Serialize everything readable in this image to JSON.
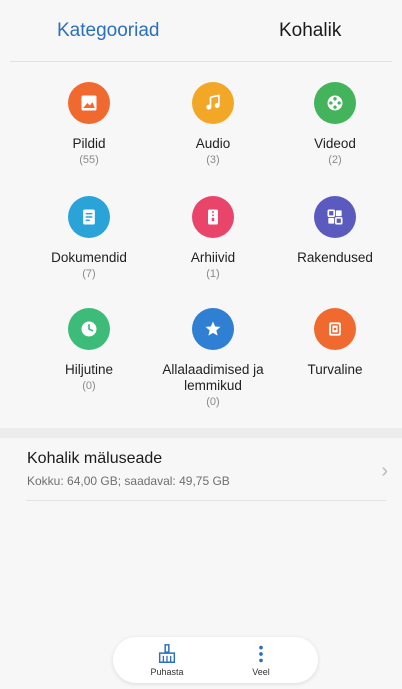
{
  "tabs": {
    "categories": "Kategooriad",
    "local": "Kohalik"
  },
  "colors": {
    "accent": "#2a6fc0",
    "pildid": "#f06a2f",
    "audio": "#f3a727",
    "videod": "#43b45b",
    "dokumendid": "#2aa3d8",
    "arhiivid": "#e9456b",
    "rakendused": "#5b5bbf",
    "hiljutine": "#3dbb79",
    "allalaadimised": "#2f7fd2",
    "turvaline": "#f06a2f"
  },
  "categories": [
    {
      "label": "Pildid",
      "count": "(55)",
      "icon": "image-icon"
    },
    {
      "label": "Audio",
      "count": "(3)",
      "icon": "music-note-icon"
    },
    {
      "label": "Videod",
      "count": "(2)",
      "icon": "film-reel-icon"
    },
    {
      "label": "Dokumendid",
      "count": "(7)",
      "icon": "document-icon"
    },
    {
      "label": "Arhiivid",
      "count": "(1)",
      "icon": "archive-zip-icon"
    },
    {
      "label": "Rakendused",
      "count": "",
      "icon": "apps-grid-icon"
    },
    {
      "label": "Hiljutine",
      "count": "(0)",
      "icon": "clock-icon"
    },
    {
      "label": "Allalaadimised ja lemmikud",
      "count": "(0)",
      "icon": "star-icon"
    },
    {
      "label": "Turvaline",
      "count": "",
      "icon": "safe-icon"
    }
  ],
  "storage": {
    "title": "Kohalik mäluseade",
    "subtitle": "Kokku: 64,00 GB; saadaval: 49,75 GB"
  },
  "bottom": {
    "clean": "Puhasta",
    "more": "Veel"
  }
}
